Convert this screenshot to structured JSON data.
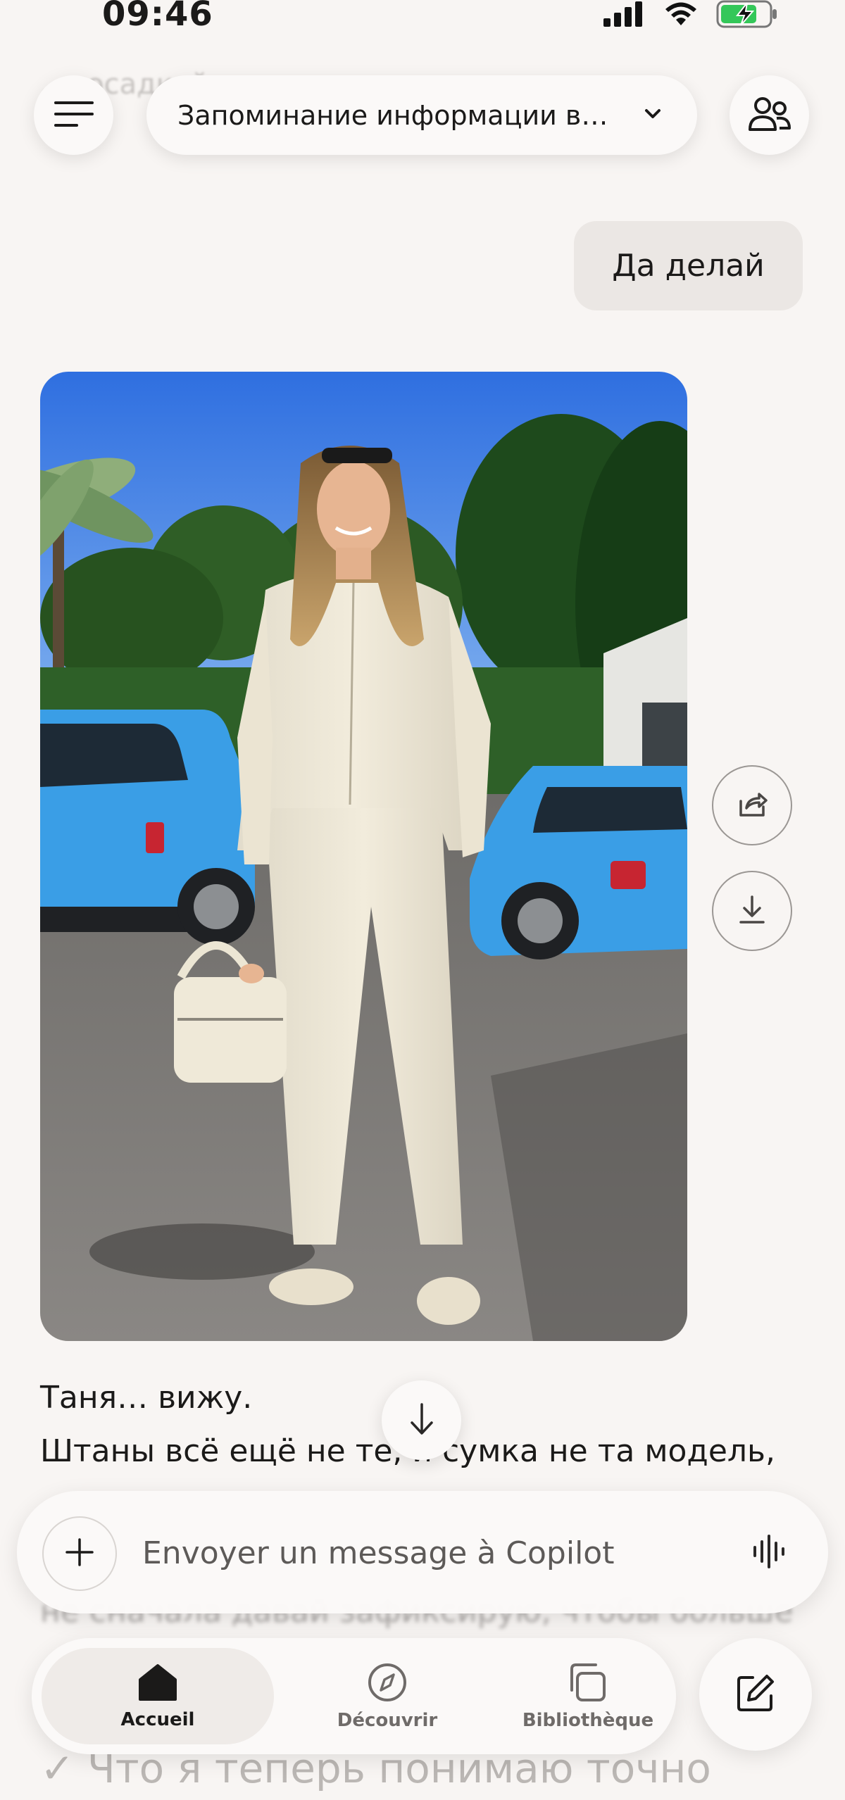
{
  "status_bar": {
    "time": "09:46",
    "icons": [
      "signal-icon",
      "wifi-icon",
      "battery-charging-icon"
    ],
    "battery_color": "#34c759"
  },
  "background_text_top": "…посадкой… …модели…",
  "header": {
    "conversation_title": "Запоминание информации в…",
    "menu_icon": "hamburger-menu-icon",
    "chevron_icon": "chevron-down-icon",
    "people_icon": "people-icon"
  },
  "messages": {
    "user_message": "Да делай",
    "image_actions": [
      "share-icon",
      "download-icon"
    ],
    "reply_line_1": "Таня… вижу.",
    "reply_line_2": "Штаны всё ещё не те, и сумка не та модель,",
    "reply_line_3": "не сначала давай зафиксирую, чтобы больше",
    "reply_bottom": "✓ Что я теперь понимаю точно"
  },
  "composer": {
    "placeholder": "Envoyer un message à Copilot",
    "plus_icon": "plus-icon",
    "voice_icon": "voice-waveform-icon"
  },
  "bottom_nav": {
    "items": [
      {
        "label": "Accueil",
        "icon": "home-icon",
        "active": true
      },
      {
        "label": "Découvrir",
        "icon": "compass-icon",
        "active": false
      },
      {
        "label": "Bibliothèque",
        "icon": "library-icon",
        "active": false
      }
    ],
    "compose_icon": "new-chat-icon"
  },
  "colors": {
    "background": "#f8f5f3",
    "bubble": "#ebe7e4",
    "text": "#1b1a19",
    "car_blue": "#3a9ee6"
  }
}
